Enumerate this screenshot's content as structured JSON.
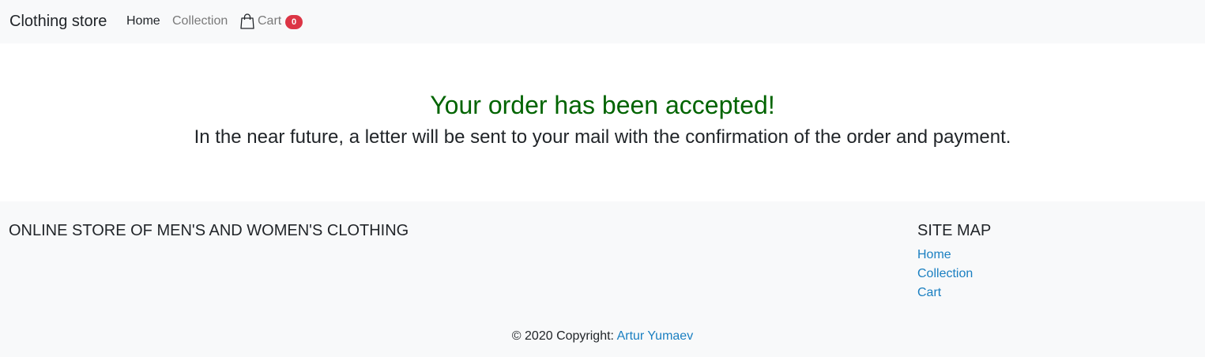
{
  "navbar": {
    "brand": "Clothing store",
    "items": [
      {
        "label": "Home"
      },
      {
        "label": "Collection"
      },
      {
        "label": "Cart"
      }
    ],
    "cart_icon": "shopping-bag-icon",
    "cart_count": "0"
  },
  "main": {
    "title": "Your order has been accepted!",
    "message": "In the near future, a letter will be sent to your mail with the confirmation of the order and payment."
  },
  "footer": {
    "store_heading": "ONLINE STORE OF MEN'S AND WOMEN'S CLOTHING",
    "sitemap_heading": "SITE MAP",
    "sitemap_links": [
      {
        "label": "Home"
      },
      {
        "label": "Collection"
      },
      {
        "label": "Cart"
      }
    ],
    "copyright_prefix": "© 2020 Copyright:",
    "copyright_author": "Artur Yumaev"
  },
  "colors": {
    "success": "#006400",
    "link": "#1a7fc1",
    "badge": "#dc3545",
    "navbar_bg": "#f8f9fa"
  }
}
